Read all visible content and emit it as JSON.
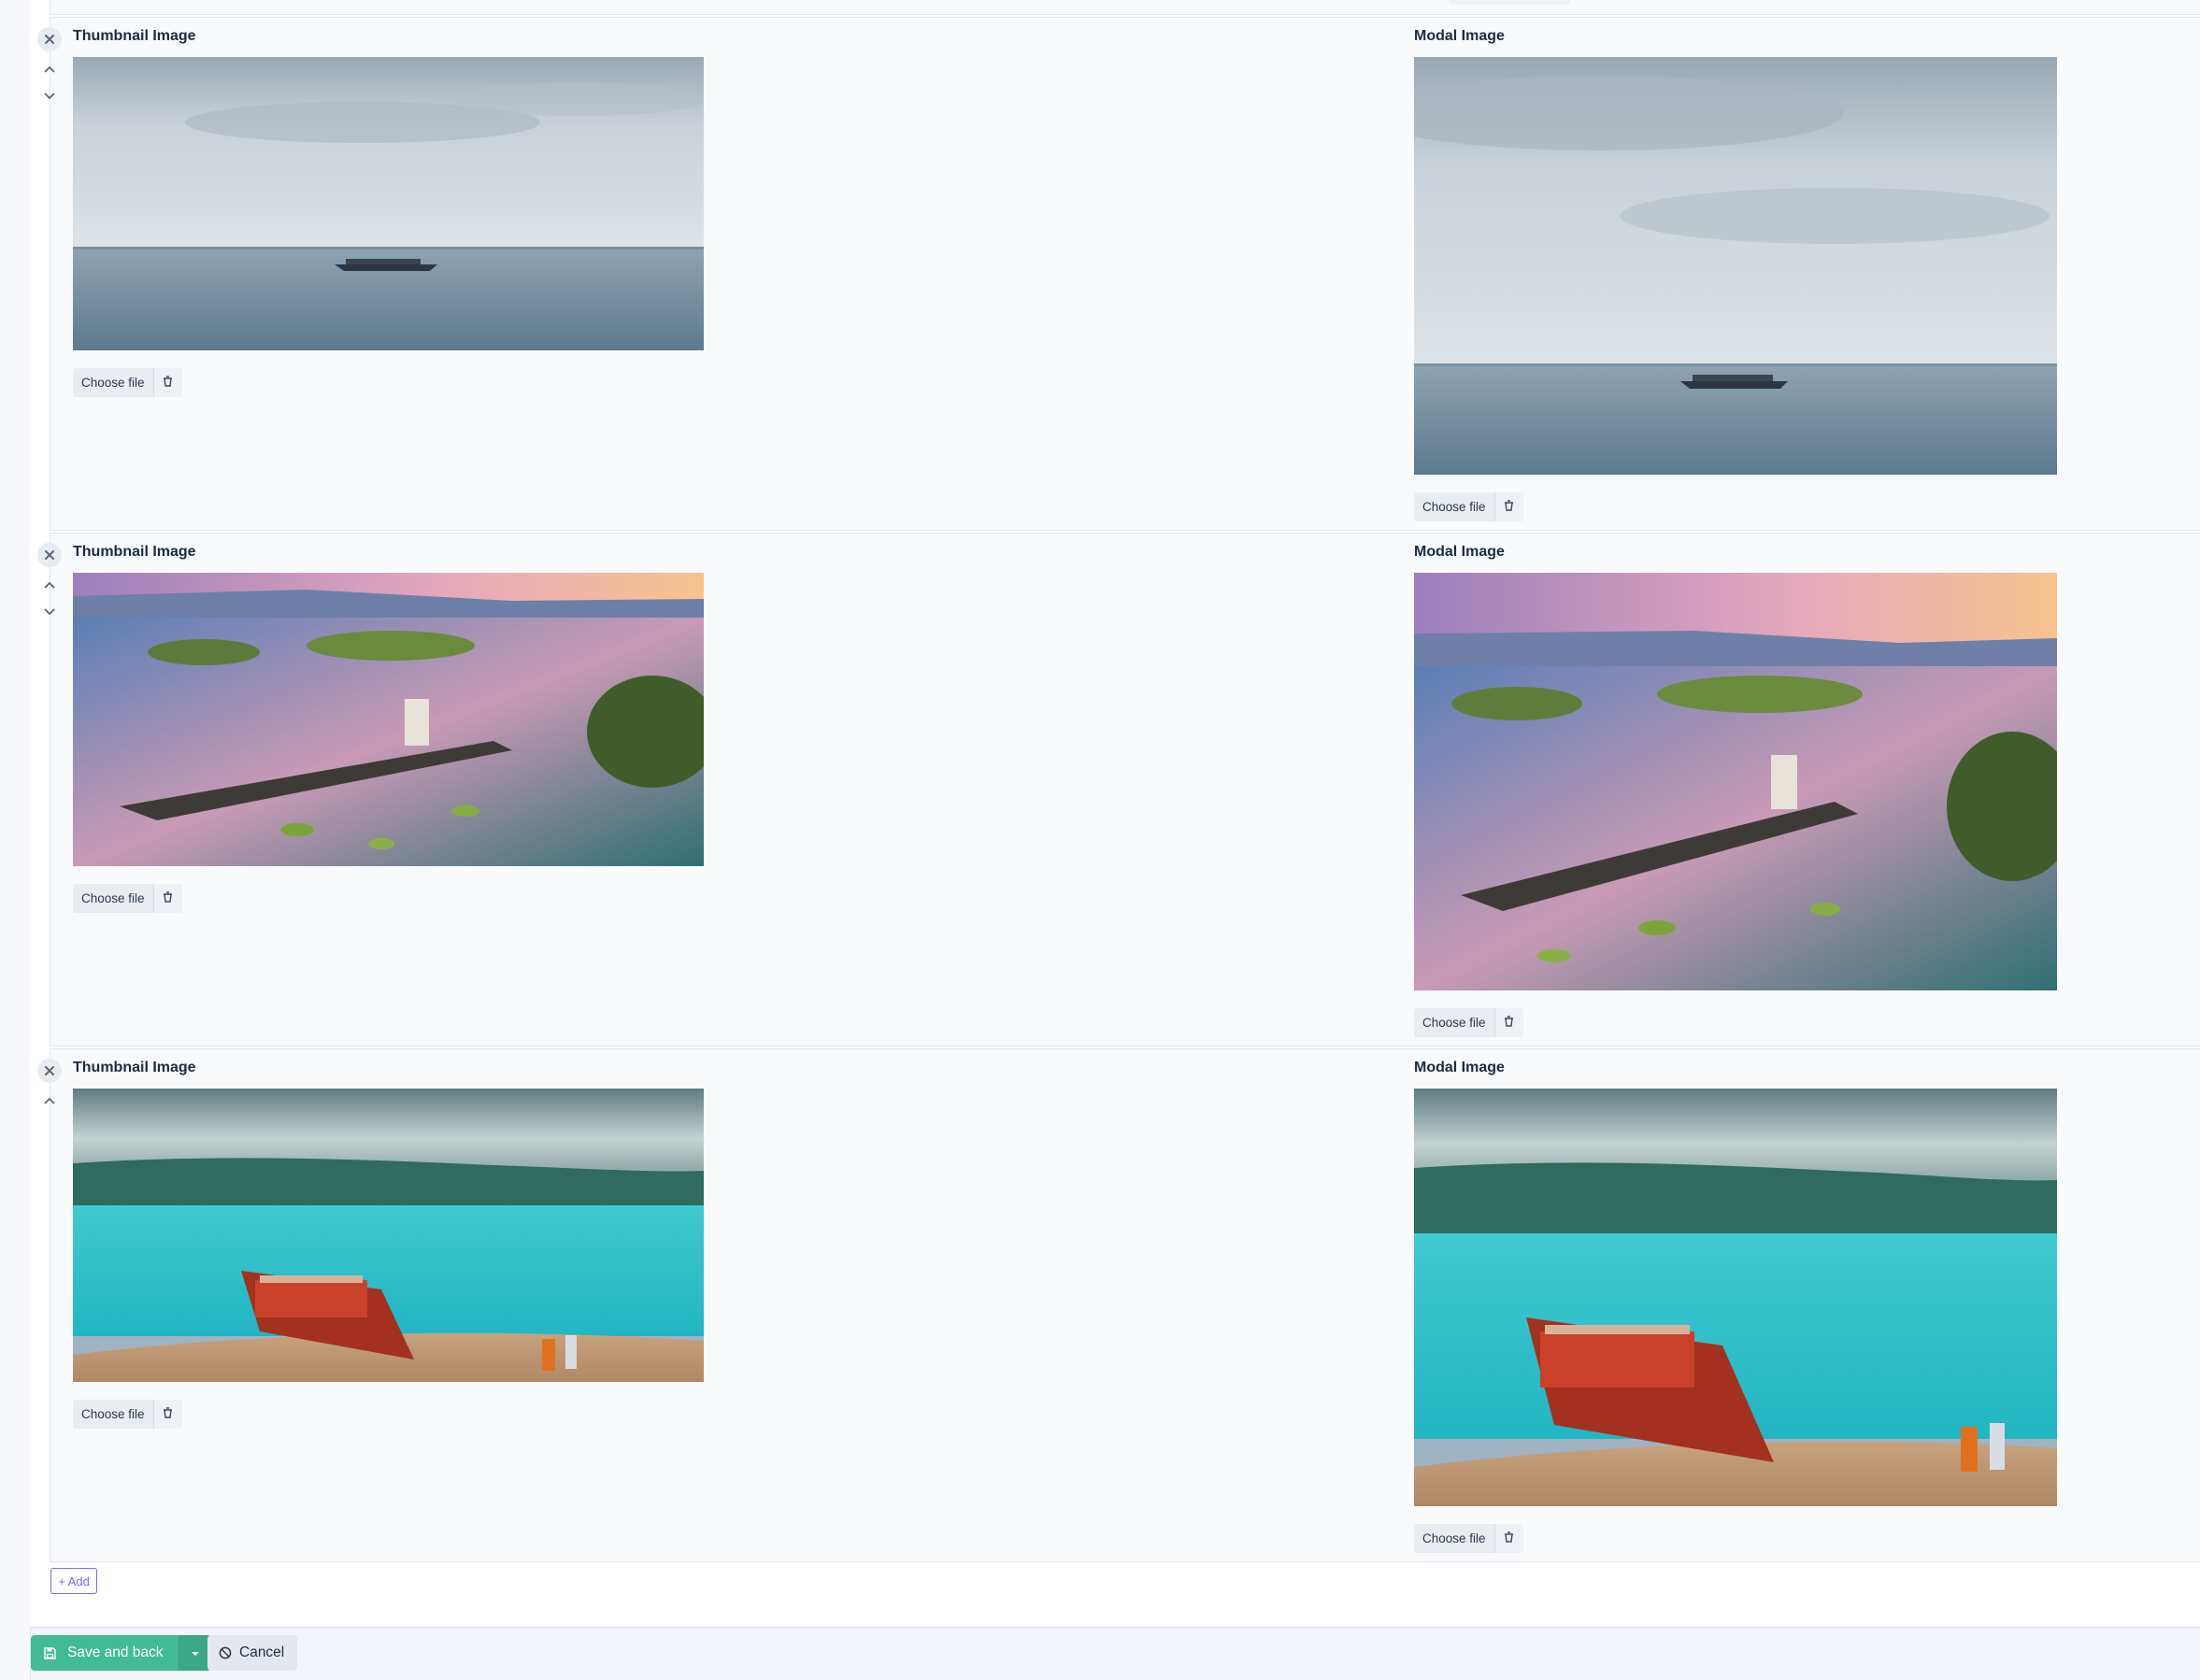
{
  "items": [
    {
      "thumbnail": {
        "label": "Thumbnail Image",
        "choose_label": "Choose file",
        "scene": "grey-lake"
      },
      "modal": {
        "label": "Modal Image",
        "choose_label": "Choose file",
        "scene": "grey-lake"
      }
    },
    {
      "thumbnail": {
        "label": "Thumbnail Image",
        "choose_label": "Choose file",
        "scene": "sunset-lake"
      },
      "modal": {
        "label": "Modal Image",
        "choose_label": "Choose file",
        "scene": "sunset-lake"
      }
    },
    {
      "thumbnail": {
        "label": "Thumbnail Image",
        "choose_label": "Choose file",
        "scene": "turquoise-shore"
      },
      "modal": {
        "label": "Modal Image",
        "choose_label": "Choose file",
        "scene": "turquoise-shore"
      }
    }
  ],
  "add_label": "+ Add",
  "actions": {
    "save_label": "Save and back",
    "cancel_label": "Cancel"
  },
  "colors": {
    "accent": "#7c69ef",
    "save": "#42ba96"
  },
  "icons": {
    "remove": "close-icon",
    "move_up": "chevron-up-icon",
    "move_down": "chevron-down-icon",
    "clear_file": "trash-icon",
    "save": "floppy-icon",
    "dropdown": "caret-down-icon",
    "cancel": "ban-icon"
  }
}
